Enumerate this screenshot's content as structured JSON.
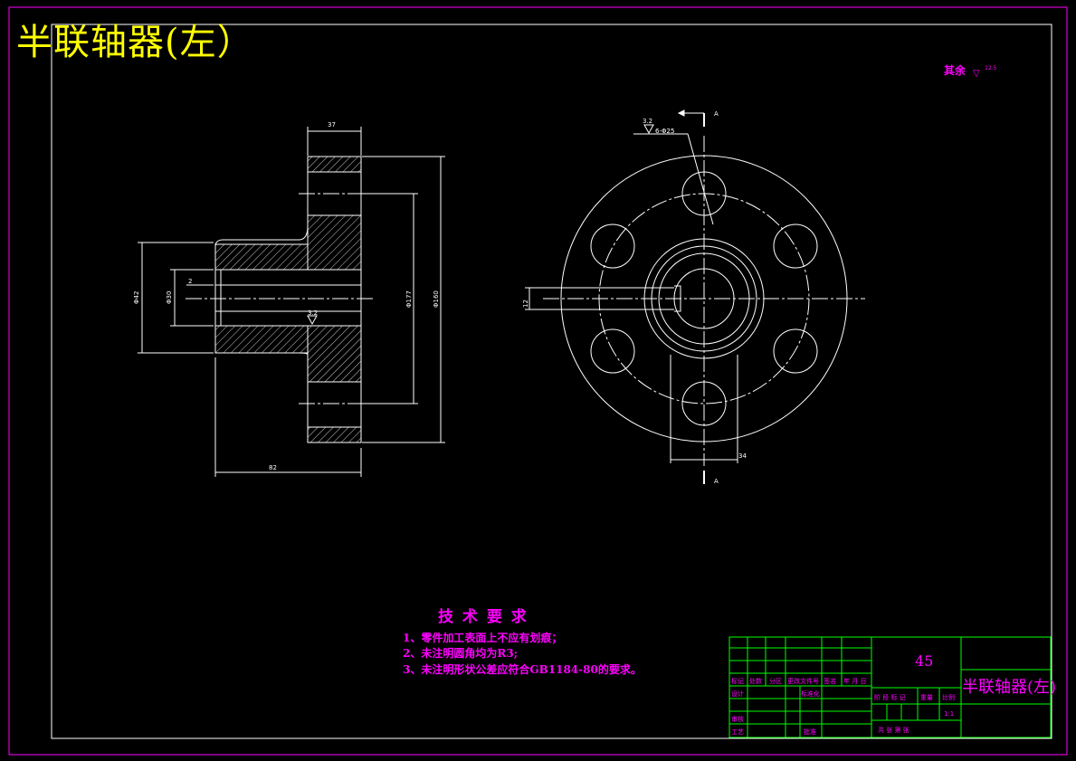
{
  "title": "半联轴器(左）",
  "roughness_note": "其余",
  "roughness_symbol": "▽",
  "roughness_value": "12.5",
  "tech": {
    "heading": "技 术 要 求",
    "items": [
      "1、零件加工表面上不应有划痕；",
      "2、未注明圆角均为R3;",
      "3、未注明形状公差应符合GB1184-80的要求。"
    ]
  },
  "dims": {
    "top_width": "37",
    "bottom_width": "82",
    "d42": "Φ42",
    "d30": "Φ30",
    "d177": "Φ177",
    "d160": "Φ160",
    "step2": "2",
    "rough_center": "3.2",
    "hole_callout": "6-Φ25",
    "rough_hole": "3.2",
    "key_width": "34",
    "key_h": "12",
    "section_top": "A",
    "section_bottom": "A"
  },
  "title_block": {
    "material": "45",
    "name": "半联轴器(左)",
    "headers": [
      "标记",
      "处数",
      "分区",
      "更改文件号",
      "签名",
      "年 月 日"
    ],
    "row_design": "设计",
    "row_std": "标准化",
    "row_check": "审核",
    "row_craft": "工艺",
    "row_approve": "批准",
    "stage_label": "阶 段 标 记",
    "weight_label": "重量",
    "scale_label": "比例",
    "scale_value": "1:1",
    "sheet_label": "共   张   第   张"
  }
}
